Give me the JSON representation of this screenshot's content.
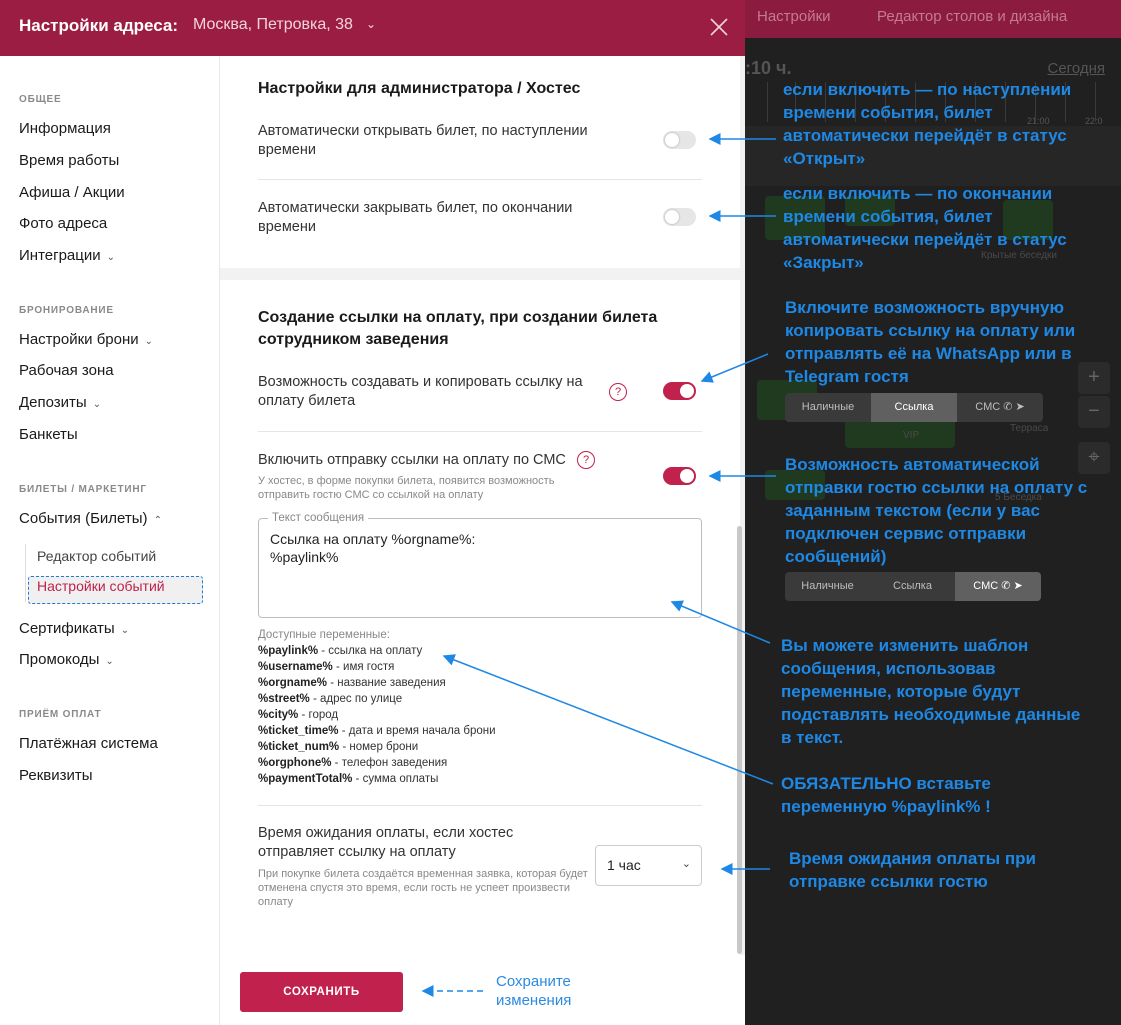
{
  "header": {
    "title": "Настройки адреса:",
    "address": "Москва, Петровка, 38",
    "chevron": "⌄"
  },
  "background": {
    "nav": [
      "Настройки",
      "Редактор столов и дизайна"
    ],
    "time": ":10 ч.",
    "today": "Сегодня",
    "hours": [
      "21:00",
      "22:0"
    ],
    "labels": [
      "Крытые беседки",
      "VIP",
      "Терраса",
      "5 Беседка"
    ]
  },
  "sidebar": {
    "sections": [
      {
        "title": "ОБЩЕЕ",
        "items": [
          "Информация",
          "Время работы",
          "Афиша / Акции",
          "Фото адреса",
          "Интеграции"
        ]
      },
      {
        "title": "БРОНИРОВАНИЕ",
        "items": [
          "Настройки брони",
          "Рабочая зона",
          "Депозиты",
          "Банкеты"
        ]
      },
      {
        "title": "БИЛЕТЫ / МАРКЕТИНГ",
        "items": [
          "События (Билеты)",
          "Сертификаты",
          "Промокоды"
        ],
        "subitems": [
          "Редактор событий",
          "Настройки событий"
        ]
      },
      {
        "title": "ПРИЁМ ОПЛАТ",
        "items": [
          "Платёжная система",
          "Реквизиты"
        ]
      }
    ]
  },
  "card1": {
    "title": "Настройки для администратора / Хостес",
    "rows": [
      {
        "label": "Автоматически открывать билет, по наступлении времени",
        "on": false
      },
      {
        "label": "Автоматически закрывать билет, по окончании времени",
        "on": false
      }
    ]
  },
  "card2": {
    "title": "Создание ссылки на оплату, при создании билета сотрудником заведения",
    "row1": {
      "label": "Возможность создавать и копировать ссылку на оплату билета",
      "on": true
    },
    "row2": {
      "label": "Включить отправку ссылки на оплату по СМС",
      "sub": "У хостес, в форме покупки билета, появится возможность отправить гостю СМС со ссылкой на оплату",
      "on": true
    },
    "message": {
      "legend": "Текст сообщения",
      "text": "Ссылка на оплату %orgname%:\n%paylink%"
    },
    "variables_title": "Доступные переменные:",
    "variables": [
      {
        "name": "%paylink%",
        "desc": " - ссылка на оплату"
      },
      {
        "name": "%username%",
        "desc": " - имя гостя"
      },
      {
        "name": "%orgname%",
        "desc": " - название заведения"
      },
      {
        "name": "%street%",
        "desc": " - адрес по улице"
      },
      {
        "name": "%city%",
        "desc": " - город"
      },
      {
        "name": "%ticket_time%",
        "desc": " - дата и время начала брони"
      },
      {
        "name": "%ticket_num%",
        "desc": " - номер брони"
      },
      {
        "name": "%orgphone%",
        "desc": " - телефон заведения"
      },
      {
        "name": "%paymentTotal%",
        "desc": " - сумма оплаты"
      }
    ],
    "wait": {
      "label": "Время ожидания оплаты, если хостес отправляет ссылку на оплату",
      "sub": "При покупке билета создаётся временная заявка, которая будет отменена спустя это время, если гость не успеет произвести оплату",
      "value": "1 час"
    }
  },
  "footer": {
    "save_label": "СОХРАНИТЬ",
    "hint": "Сохраните изменения"
  },
  "annotations": {
    "a1": "если включить — по наступлении времени события, билет автоматически перейдёт в статус «Открыт»",
    "a2": "если включить — по окончании времени события, билет автоматически перейдёт в статус «Закрыт»",
    "a3": "Включите возможность вручную копировать ссылку на оплату или отправлять её на WhatsApp или в Telegram гостя",
    "a4": "Возможность автоматической отправки гостю ссылки на оплату с заданным текстом (если у вас подключен сервис отправки сообщений)",
    "a5": "Вы можете изменить шаблон сообщения, использовав переменные, которые будут подставлять необходимые данные в текст.",
    "a6": "ОБЯЗАТЕЛЬНО вставьте переменную %paylink% !",
    "a7": "Время ожидания оплаты при отправке ссылки гостю"
  },
  "segments": {
    "options": [
      "Наличные",
      "Ссылка",
      "СМС"
    ],
    "first_active": "Ссылка",
    "second_active": "СМС"
  },
  "colors": {
    "header": "#9c1d44",
    "accent": "#c0214d",
    "annotation": "#1e88e5"
  }
}
